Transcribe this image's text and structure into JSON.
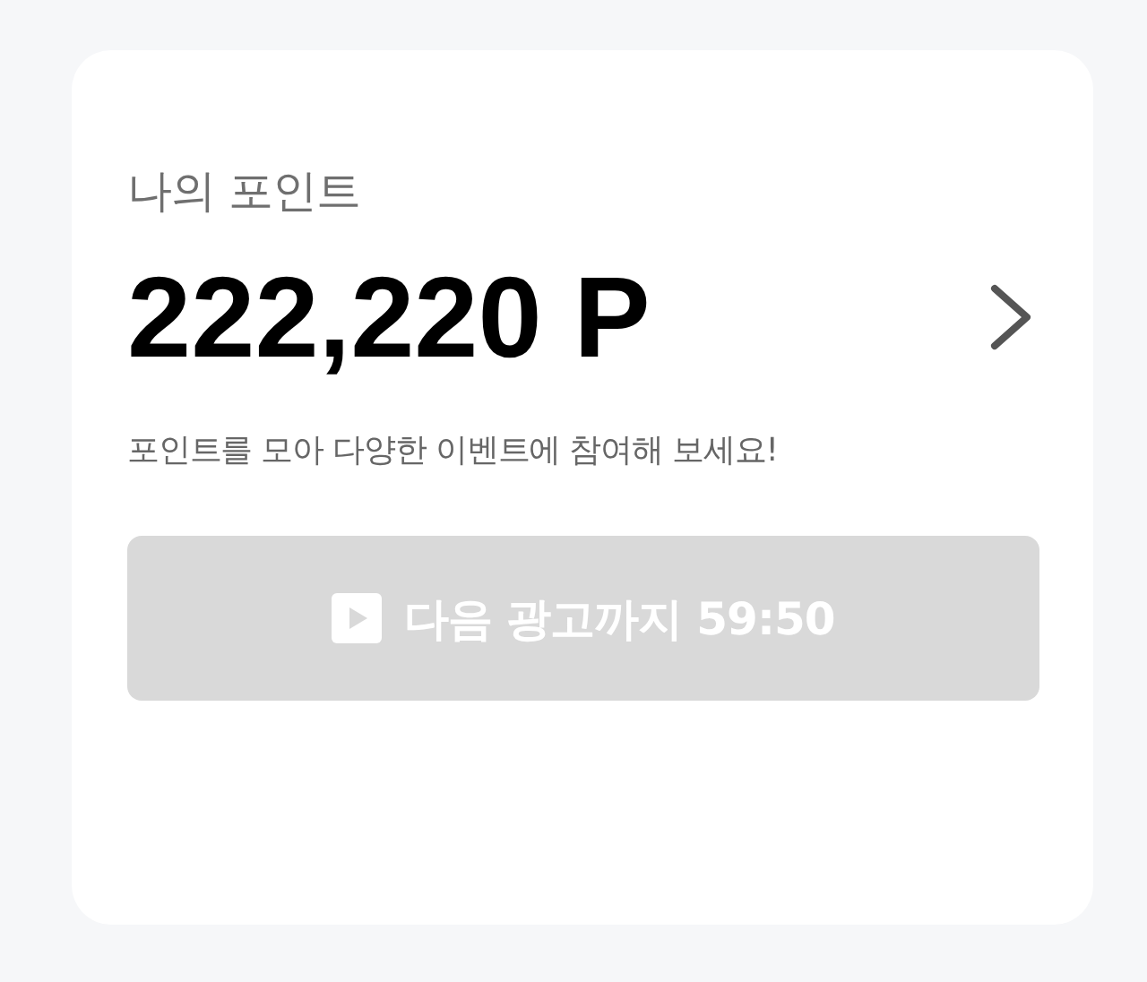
{
  "card": {
    "title": "나의 포인트",
    "amount": "222,220 P",
    "description": "포인트를 모아 다양한 이벤트에 참여해 보세요!"
  },
  "ad_button": {
    "label": "다음 광고까지 59:50",
    "disabled": true
  }
}
